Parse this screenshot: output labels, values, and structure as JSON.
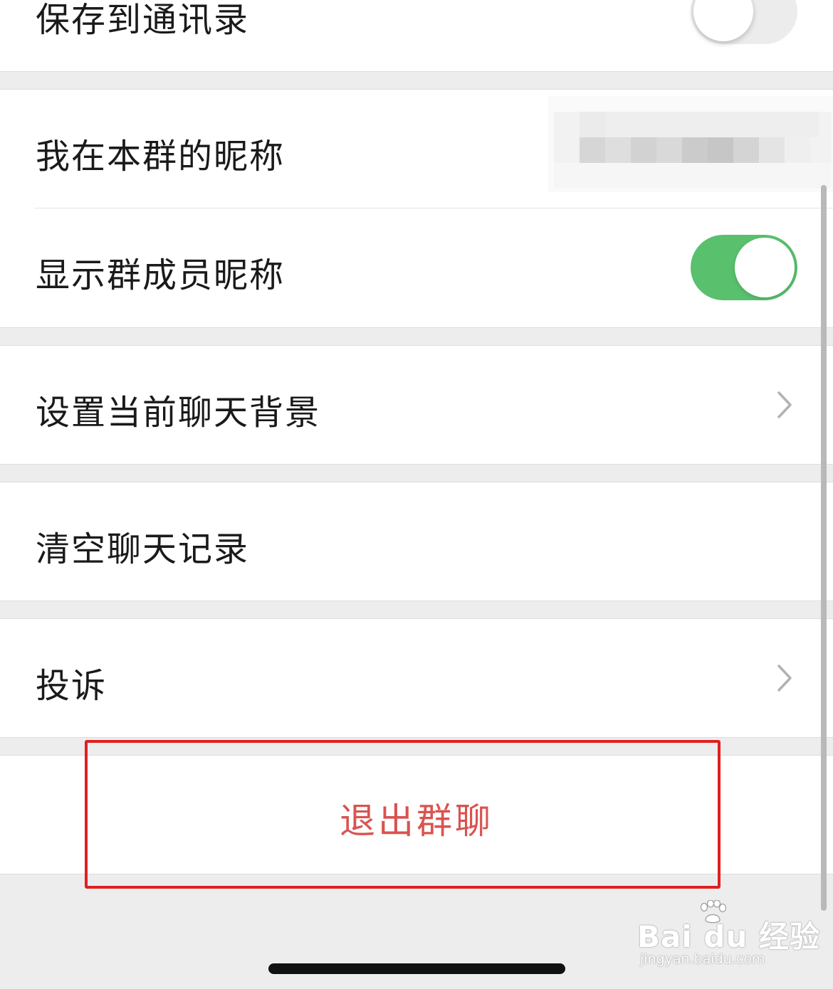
{
  "settings": {
    "save_to_contacts": {
      "label": "保存到通讯录",
      "enabled": false
    },
    "my_group_nickname": {
      "label": "我在本群的昵称",
      "value_obscured": true
    },
    "show_member_nicknames": {
      "label": "显示群成员昵称",
      "enabled": true
    },
    "chat_background": {
      "label": "设置当前聊天背景"
    },
    "clear_history": {
      "label": "清空聊天记录"
    },
    "complain": {
      "label": "投诉"
    },
    "exit_group": {
      "label": "退出群聊"
    }
  },
  "watermark": {
    "brand": "Bai du 经验",
    "url": "jingyan.baidu.com"
  },
  "colors": {
    "accent_green": "#59c06d",
    "danger_red": "#d9534f",
    "highlight_red": "#e02020",
    "page_background": "#ededed"
  },
  "icons": {
    "chevron": "chevron-right-icon",
    "watermark_paw": "baidu-paw-icon"
  }
}
